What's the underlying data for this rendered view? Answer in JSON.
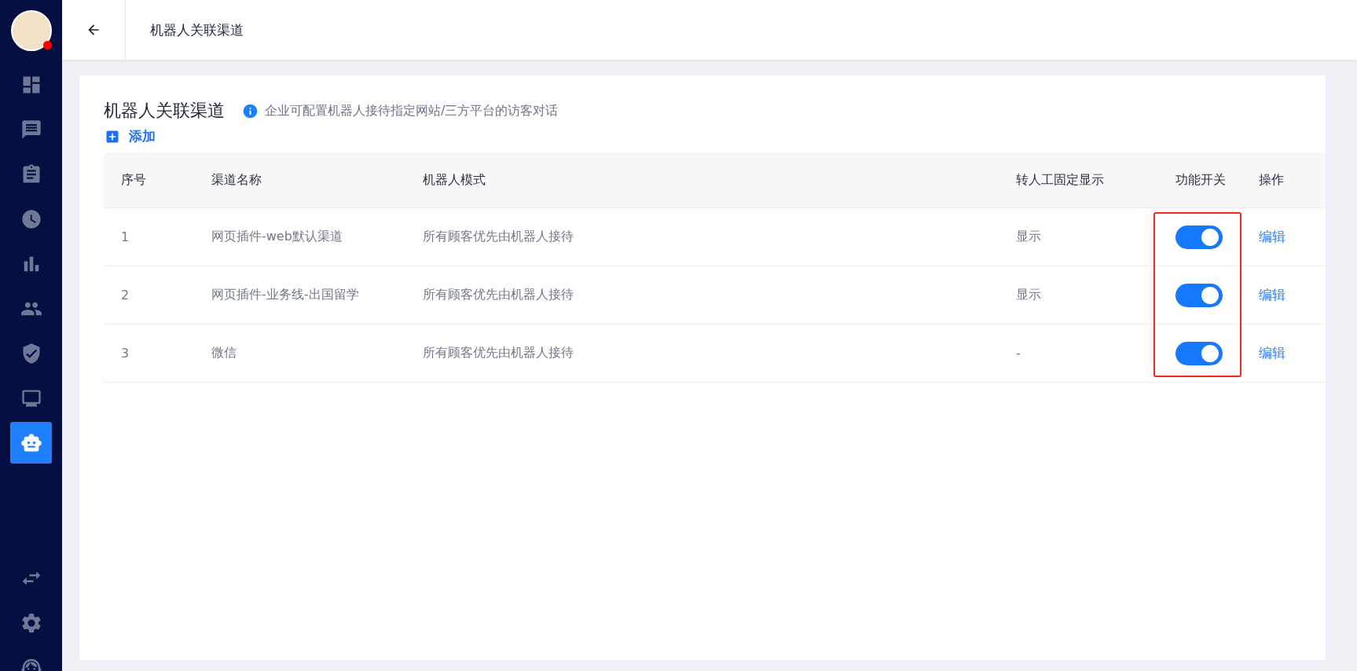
{
  "sidebar": {
    "items": [
      {
        "selected": false
      },
      {
        "selected": false
      },
      {
        "selected": false
      },
      {
        "selected": false
      },
      {
        "selected": false
      },
      {
        "selected": false
      },
      {
        "selected": false
      },
      {
        "selected": false
      },
      {
        "selected": true
      }
    ],
    "bottom_items": [
      {
        "selected": false
      },
      {
        "selected": false
      },
      {
        "selected": false
      }
    ],
    "avatar": {
      "online_dot": true
    }
  },
  "header": {
    "title": "机器人关联渠道"
  },
  "card": {
    "title": "机器人关联渠道",
    "hint": "企业可配置机器人接待指定网站/三方平台的访客对话",
    "add_label": "添加"
  },
  "table": {
    "columns": [
      "序号",
      "渠道名称",
      "机器人模式",
      "转人工固定显示",
      "功能开关",
      "操作"
    ],
    "switches_highlighted": true,
    "rows": [
      {
        "index": "1",
        "channel": "网页插件-web默认渠道",
        "mode": "所有顾客优先由机器人接待",
        "fixed_display": "显示",
        "on": true,
        "action": "编辑"
      },
      {
        "index": "2",
        "channel": "网页插件-业务线-出国留学",
        "mode": "所有顾客优先由机器人接待",
        "fixed_display": "显示",
        "on": true,
        "action": "编辑"
      },
      {
        "index": "3",
        "channel": "微信",
        "mode": "所有顾客优先由机器人接待",
        "fixed_display": "-",
        "on": true,
        "action": "编辑"
      }
    ]
  }
}
